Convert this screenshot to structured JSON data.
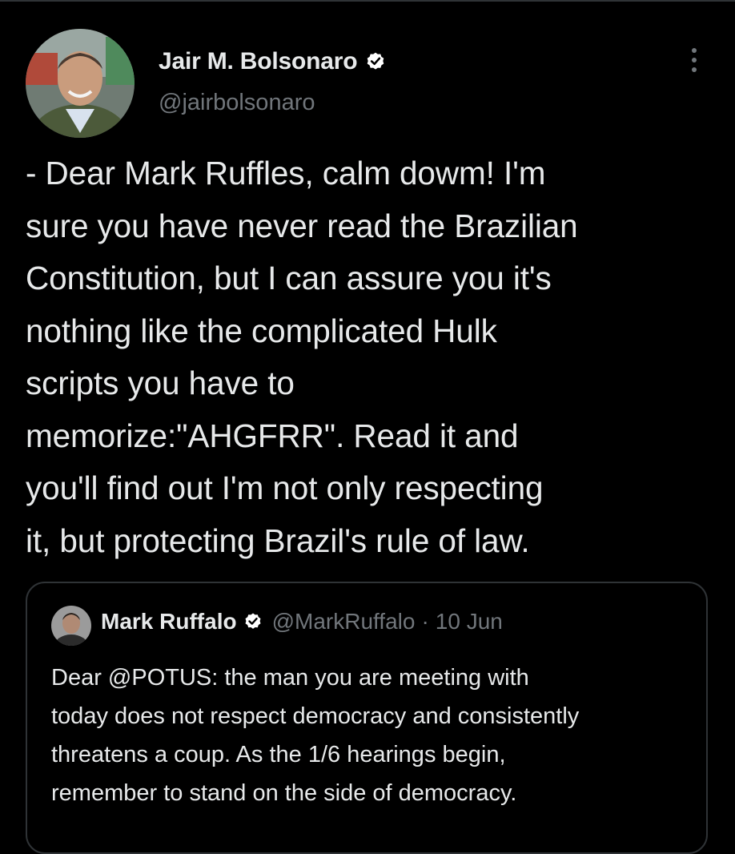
{
  "tweet": {
    "author": {
      "display_name": "Jair M. Bolsonaro",
      "handle": "@jairbolsonaro",
      "verified": true,
      "avatar_icon": "avatar-photo-icon"
    },
    "more_icon": "more-options-icon",
    "text": "- Dear Mark Ruffles, calm dowm! I'm\nsure you have never read the Brazilian\nConstitution, but I can assure you it's\nnothing like the complicated Hulk\nscripts you have to\nmemorize:\"AHGFRR\". Read it and\nyou'll find out I'm not only respecting\nit, but protecting Brazil's rule of law."
  },
  "quoted_tweet": {
    "author": {
      "display_name": "Mark Ruffalo",
      "handle": "@MarkRuffalo",
      "verified": true,
      "avatar_icon": "avatar-photo-icon"
    },
    "separator": "·",
    "date": "10 Jun",
    "text": "Dear @POTUS: the man you are meeting with\ntoday does not respect democracy and consistently\nthreatens a coup. As the 1/6 hearings begin,\nremember to stand on the side of democracy."
  },
  "colors": {
    "background": "#000000",
    "primary_text": "#e7e9ea",
    "secondary_text": "#71767b",
    "border": "#2f3336",
    "verified_badge": "#ffffff"
  }
}
